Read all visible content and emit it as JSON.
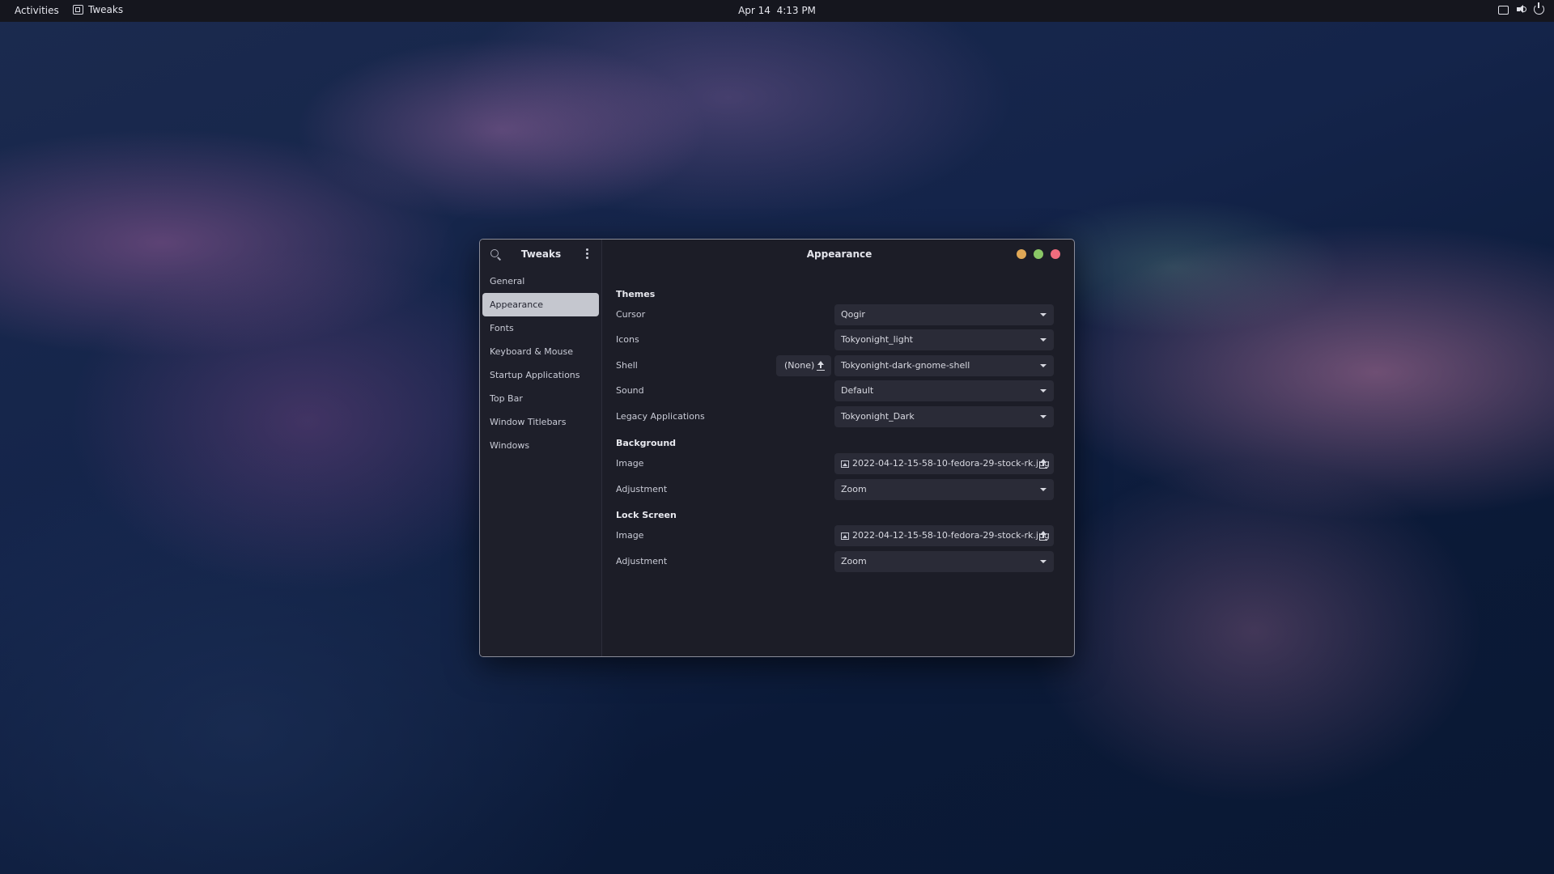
{
  "topbar": {
    "activities": "Activities",
    "app_name": "Tweaks",
    "date": "Apr 14",
    "time": "4:13 PM",
    "tray_icons": [
      "screen-icon",
      "volume-icon",
      "power-icon"
    ]
  },
  "window": {
    "sidebar_title": "Tweaks",
    "content_title": "Appearance",
    "controls": {
      "minimize_color": "#e0a856",
      "maximize_color": "#8ac766",
      "close_color": "#f16c7e"
    }
  },
  "sidebar": {
    "items": [
      {
        "label": "General",
        "active": false
      },
      {
        "label": "Appearance",
        "active": true
      },
      {
        "label": "Fonts",
        "active": false
      },
      {
        "label": "Keyboard & Mouse",
        "active": false
      },
      {
        "label": "Startup Applications",
        "active": false
      },
      {
        "label": "Top Bar",
        "active": false
      },
      {
        "label": "Window Titlebars",
        "active": false
      },
      {
        "label": "Windows",
        "active": false
      }
    ]
  },
  "themes": {
    "title": "Themes",
    "cursor": {
      "label": "Cursor",
      "value": "Qogir"
    },
    "icons": {
      "label": "Icons",
      "value": "Tokyonight_light"
    },
    "shell": {
      "label": "Shell",
      "none_label": "(None)",
      "value": "Tokyonight-dark-gnome-shell"
    },
    "sound": {
      "label": "Sound",
      "value": "Default"
    },
    "legacy": {
      "label": "Legacy Applications",
      "value": "Tokyonight_Dark"
    }
  },
  "background": {
    "title": "Background",
    "image": {
      "label": "Image",
      "value": "2022-04-12-15-58-10-fedora-29-stock-rk.jpg"
    },
    "adjustment": {
      "label": "Adjustment",
      "value": "Zoom"
    }
  },
  "lockscreen": {
    "title": "Lock Screen",
    "image": {
      "label": "Image",
      "value": "2022-04-12-15-58-10-fedora-29-stock-rk.jpg"
    },
    "adjustment": {
      "label": "Adjustment",
      "value": "Zoom"
    }
  }
}
